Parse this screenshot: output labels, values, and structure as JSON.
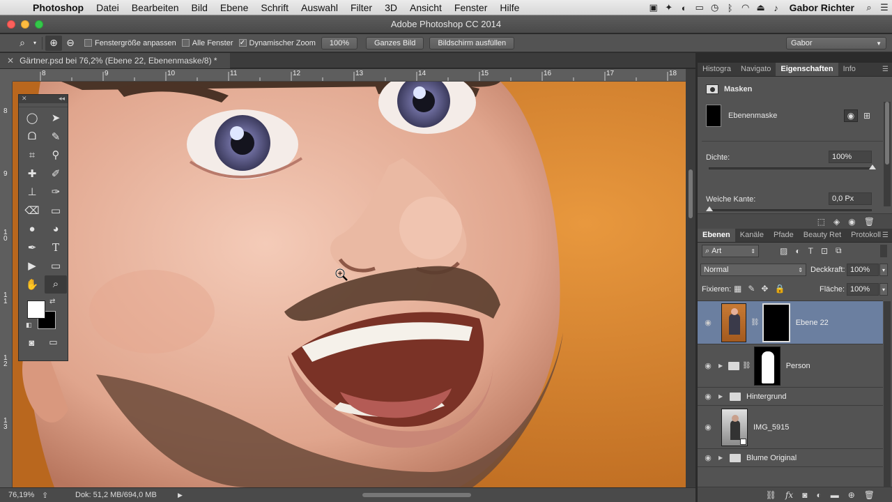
{
  "menubar": {
    "app": "Photoshop",
    "items": [
      "Datei",
      "Bearbeiten",
      "Bild",
      "Ebene",
      "Schrift",
      "Auswahl",
      "Filter",
      "3D",
      "Ansicht",
      "Fenster",
      "Hilfe"
    ],
    "user": "Gabor Richter"
  },
  "window": {
    "title": "Adobe Photoshop CC 2014"
  },
  "options": {
    "fit_window": "Fenstergröße anpassen",
    "all_windows": "Alle Fenster",
    "scrubby_zoom": "Dynamischer Zoom",
    "zoom100": "100%",
    "fit_screen": "Ganzes Bild",
    "fill_screen": "Bildschirm ausfüllen",
    "workspace": "Gabor"
  },
  "document": {
    "tab_title": "Gärtner.psd bei 76,2% (Ebene 22, Ebenenmaske/8) *",
    "ruler_h": [
      "8",
      "9",
      "10",
      "11",
      "12",
      "13",
      "14",
      "15",
      "16",
      "17",
      "18"
    ],
    "ruler_v": [
      "8",
      "9",
      "1\n0",
      "1\n1",
      "1\n2",
      "1\n3"
    ]
  },
  "status": {
    "zoom": "76,19%",
    "doc": "Dok: 51,2 MB/694,0 MB"
  },
  "panel_top": {
    "tabs": [
      "Histogra",
      "Navigato",
      "Eigenschaften",
      "Info"
    ],
    "active_tab": "Eigenschaften",
    "section": "Masken",
    "mask_name": "Ebenenmaske",
    "density_label": "Dichte:",
    "density_value": "100%",
    "density_level": 1.0,
    "feather_label": "Weiche Kante:",
    "feather_value": "0,0 Px",
    "feather_level": 0.0
  },
  "layers_panel": {
    "tabs": [
      "Ebenen",
      "Kanäle",
      "Pfade",
      "Beauty Ret",
      "Protokoll"
    ],
    "active_tab": "Ebenen",
    "filter": "Art",
    "blend_mode": "Normal",
    "opacity_label": "Deckkraft:",
    "opacity_value": "100%",
    "lock_label": "Fixieren:",
    "fill_label": "Fläche:",
    "fill_value": "100%",
    "layers": [
      {
        "name": "Ebene 22",
        "type": "layer-with-mask",
        "selected": true
      },
      {
        "name": "Person",
        "type": "group-with-mask",
        "selected": false
      },
      {
        "name": "Hintergrund",
        "type": "group",
        "selected": false
      },
      {
        "name": "IMG_5915",
        "type": "smart-object",
        "selected": false
      },
      {
        "name": "Blume Original",
        "type": "group",
        "selected": false
      }
    ]
  },
  "colors": {
    "accent_selected_layer": "#6b7fa0",
    "canvas_background": "#d4852f"
  }
}
